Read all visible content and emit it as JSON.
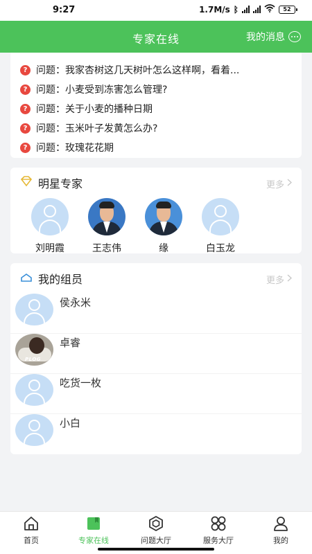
{
  "status_bar": {
    "time": "9:27",
    "speed": "1.7M/s",
    "battery": "52"
  },
  "header": {
    "title": "专家在线",
    "messages_label": "我的消息"
  },
  "questions": {
    "prefix": "问题：",
    "items": [
      "问题：我家杏树这几天树叶怎么这样啊，看着...",
      "问题：小麦受到冻害怎么管理?",
      "问题：关于小麦的播种日期",
      "问题：玉米叶子发黄怎么办?",
      "问题：玫瑰花花期"
    ]
  },
  "star_experts": {
    "title": "明星专家",
    "more_label": "更多",
    "experts": [
      {
        "name": "刘明霞",
        "avatar": "default-avatar-icon"
      },
      {
        "name": "王志伟",
        "avatar": "photo"
      },
      {
        "name": "缘",
        "avatar": "photo"
      },
      {
        "name": "白玉龙",
        "avatar": "default-avatar-icon"
      }
    ]
  },
  "my_members": {
    "title": "我的组员",
    "more_label": "更多",
    "members": [
      {
        "name": "侯永米",
        "avatar": "default-avatar-icon"
      },
      {
        "name": "卓睿",
        "avatar": "photo",
        "avatar_text": "PLOG"
      },
      {
        "name": "吃货一枚",
        "avatar": "default-avatar-icon"
      },
      {
        "name": "小白",
        "avatar": "default-avatar-icon"
      }
    ]
  },
  "tabbar": {
    "tabs": [
      {
        "label": "首页",
        "icon": "home-icon",
        "active": false
      },
      {
        "label": "专家在线",
        "icon": "book-icon",
        "active": true
      },
      {
        "label": "问题大厅",
        "icon": "hexagon-icon",
        "active": false
      },
      {
        "label": "服务大厅",
        "icon": "clover-icon",
        "active": false
      },
      {
        "label": "我的",
        "icon": "person-icon",
        "active": false
      }
    ]
  },
  "colors": {
    "brand_green": "#4cc25a",
    "question_red": "#e8483f",
    "avatar_blue": "#c6def6"
  }
}
